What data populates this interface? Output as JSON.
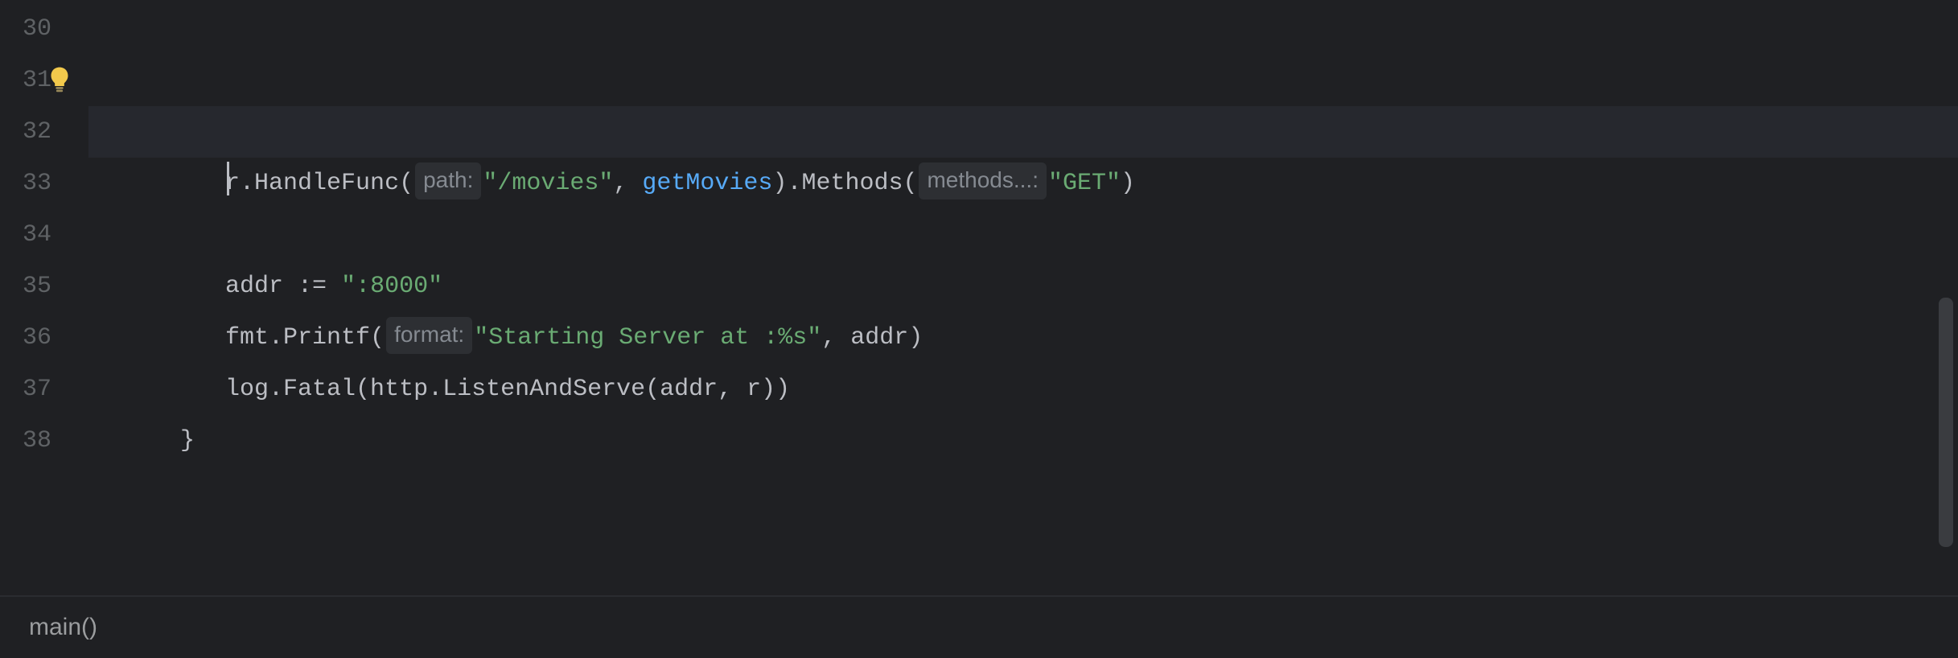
{
  "gutter": {
    "lines": [
      "30",
      "31",
      "32",
      "33",
      "34",
      "35",
      "36",
      "37",
      "38"
    ]
  },
  "code": {
    "line31": {
      "r_handlefunc": "r.HandleFunc(",
      "hint_path": "path:",
      "str_movies": "\"/movies\"",
      "comma1": ", ",
      "getMovies": "getMovies",
      "close_methods": ").Methods(",
      "hint_methods": "methods...:",
      "str_get": "\"GET\"",
      "close_paren": ")"
    },
    "line34": {
      "addr_decl": "addr := ",
      "addr_val": "\":8000\""
    },
    "line35": {
      "fmt_printf": "fmt.Printf(",
      "hint_format": "format:",
      "str_starting": "\"Starting Server at :%s\"",
      "comma_addr": ", addr)"
    },
    "line36": {
      "log_fatal": "log.Fatal(http.ListenAndServe(addr, r))"
    },
    "line37": {
      "brace": "}"
    }
  },
  "statusbar": {
    "breadcrumb": "main()"
  },
  "icons": {
    "bulb": "lightbulb-icon"
  }
}
